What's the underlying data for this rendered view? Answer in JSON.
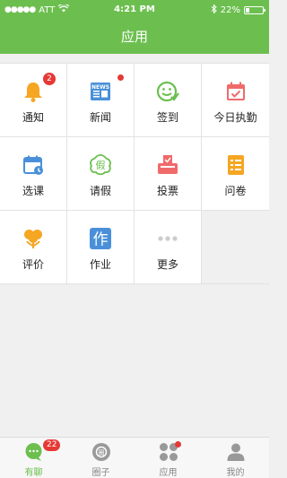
{
  "status_bar": {
    "carrier": "ATT",
    "time": "4:21 PM",
    "battery": "22%",
    "battery_level": 0.22
  },
  "header": {
    "title": "应用"
  },
  "apps": [
    {
      "label": "通知",
      "icon": "bell-icon",
      "color": "#f5a623",
      "badge": "2"
    },
    {
      "label": "新闻",
      "icon": "news-icon",
      "color": "#4a90d9",
      "dot": true
    },
    {
      "label": "签到",
      "icon": "check-in-icon",
      "color": "#6cbf4f"
    },
    {
      "label": "今日执勤",
      "icon": "calendar-duty-icon",
      "color": "#f06a6a"
    },
    {
      "label": "选课",
      "icon": "calendar-course-icon",
      "color": "#4a90d9"
    },
    {
      "label": "请假",
      "icon": "leave-icon",
      "color": "#6cbf4f",
      "icon_text": "假"
    },
    {
      "label": "投票",
      "icon": "ballot-box-icon",
      "color": "#f06a6a"
    },
    {
      "label": "问卷",
      "icon": "questionnaire-icon",
      "color": "#f5a623"
    },
    {
      "label": "评价",
      "icon": "flower-icon",
      "color": "#f5a623"
    },
    {
      "label": "作业",
      "icon": "homework-icon",
      "color": "#4a90d9",
      "icon_text": "作"
    },
    {
      "label": "更多",
      "icon": "more-icon",
      "color": "#cccccc"
    }
  ],
  "tabbar": [
    {
      "label": "有聊",
      "icon": "chat-icon",
      "badge": "22",
      "active": true
    },
    {
      "label": "圈子",
      "icon": "circle-icon"
    },
    {
      "label": "应用",
      "icon": "apps-icon",
      "dot": true
    },
    {
      "label": "我的",
      "icon": "user-icon"
    }
  ],
  "colors": {
    "brand": "#6cbf4f",
    "badge": "#e53935"
  }
}
